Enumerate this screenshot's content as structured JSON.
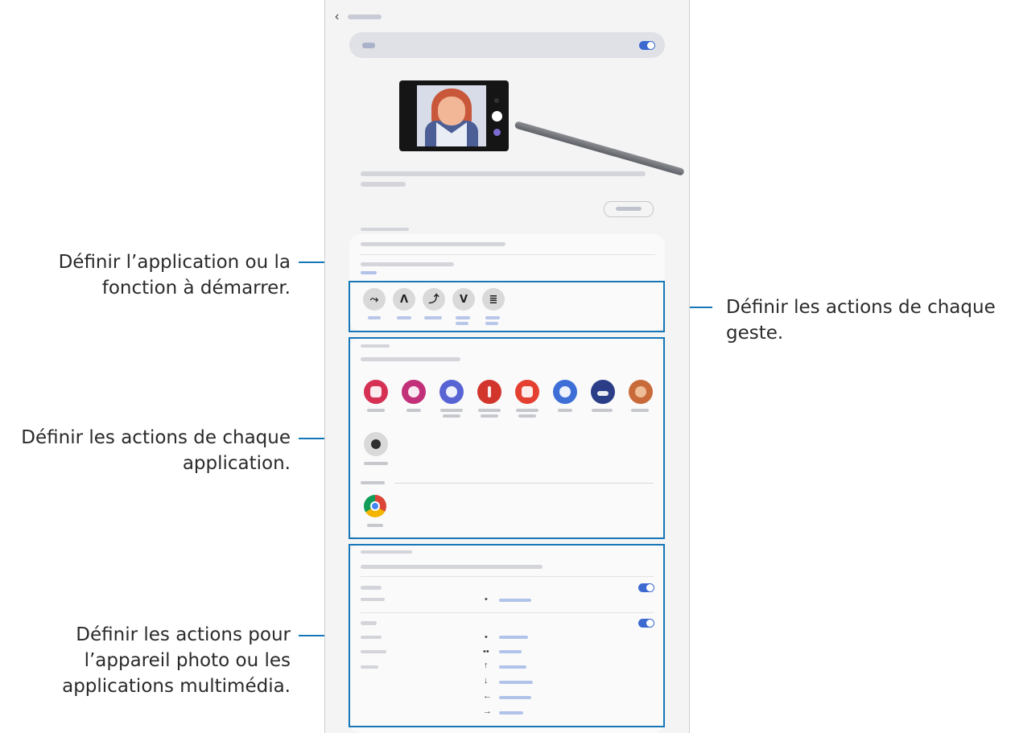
{
  "callouts": {
    "app_function": [
      "Définir l’application ou la",
      "fonction à démarrer."
    ],
    "gestures": [
      "Définir les actions de chaque",
      "geste."
    ],
    "app_actions": [
      "Définir les actions de chaque",
      "application."
    ],
    "camera_media": [
      "Définir les actions pour",
      "l’appareil photo ou les",
      "applications multimédia."
    ]
  },
  "gesture_icons": [
    "⤳",
    "ᐱ",
    "⤴",
    "ᐯ",
    "≣"
  ],
  "colors": {
    "highlight": "#1577b8",
    "toggle_on": "#3c6ad1"
  },
  "apps": [
    {
      "icon": "camera-icon",
      "color": "#d63054"
    },
    {
      "icon": "gallery-icon",
      "color": "#c2307a"
    },
    {
      "icon": "internet-icon",
      "color": "#5864d4"
    },
    {
      "icon": "voice-recorder-icon",
      "color": "#d2352c"
    },
    {
      "icon": "notes-icon",
      "color": "#e44031"
    },
    {
      "icon": "screen-recorder-icon",
      "color": "#3d6fd6"
    },
    {
      "icon": "drawing-icon",
      "color": "#2a3d86"
    },
    {
      "icon": "ar-emoji-icon",
      "color": "#c96a3a"
    },
    {
      "icon": "penup-icon",
      "color": "#c8c8c8"
    },
    {
      "icon": "chrome-icon",
      "color": "#e5a818"
    }
  ]
}
